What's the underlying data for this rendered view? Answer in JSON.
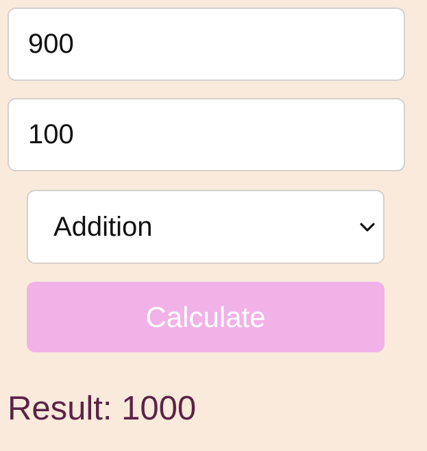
{
  "inputs": {
    "first_value": "900",
    "second_value": "100"
  },
  "operation": {
    "selected": "Addition",
    "icon": "chevron-down-icon"
  },
  "button": {
    "label": "Calculate"
  },
  "result": {
    "text": "Result: 1000"
  },
  "colors": {
    "background": "#f9eadb",
    "button": "#f1b2e8",
    "result_text": "#5b2347"
  }
}
